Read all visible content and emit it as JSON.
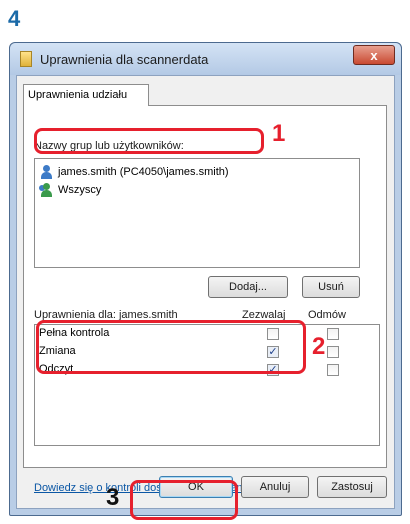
{
  "step": "4",
  "window": {
    "title": "Uprawnienia dla scannerdata",
    "close_glyph": "x"
  },
  "tab": {
    "label": "Uprawnienia udziału"
  },
  "users": {
    "caption": "Nazwy grup lub użytkowników:",
    "items": [
      {
        "name": "james.smith (PC4050\\james.smith)",
        "icon": "user-icon"
      },
      {
        "name": "Wszyscy",
        "icon": "group-icon"
      }
    ]
  },
  "buttons": {
    "add": "Dodaj...",
    "remove": "Usuń",
    "ok": "OK",
    "cancel": "Anuluj",
    "apply": "Zastosuj"
  },
  "permissions": {
    "caption": "Uprawnienia dla: james.smith",
    "allow_header": "Zezwalaj",
    "deny_header": "Odmów",
    "rows": [
      {
        "name": "Pełna kontrola",
        "allow": false,
        "deny": false
      },
      {
        "name": "Zmiana",
        "allow": true,
        "deny": false
      },
      {
        "name": "Odczyt",
        "allow": true,
        "deny": false
      }
    ]
  },
  "link": "Dowiedz się o kontroli dostępu i uprawnieniach",
  "annotations": {
    "step1": "1",
    "step2": "2",
    "step3": "3",
    "highlight_color": "#e6202d"
  }
}
